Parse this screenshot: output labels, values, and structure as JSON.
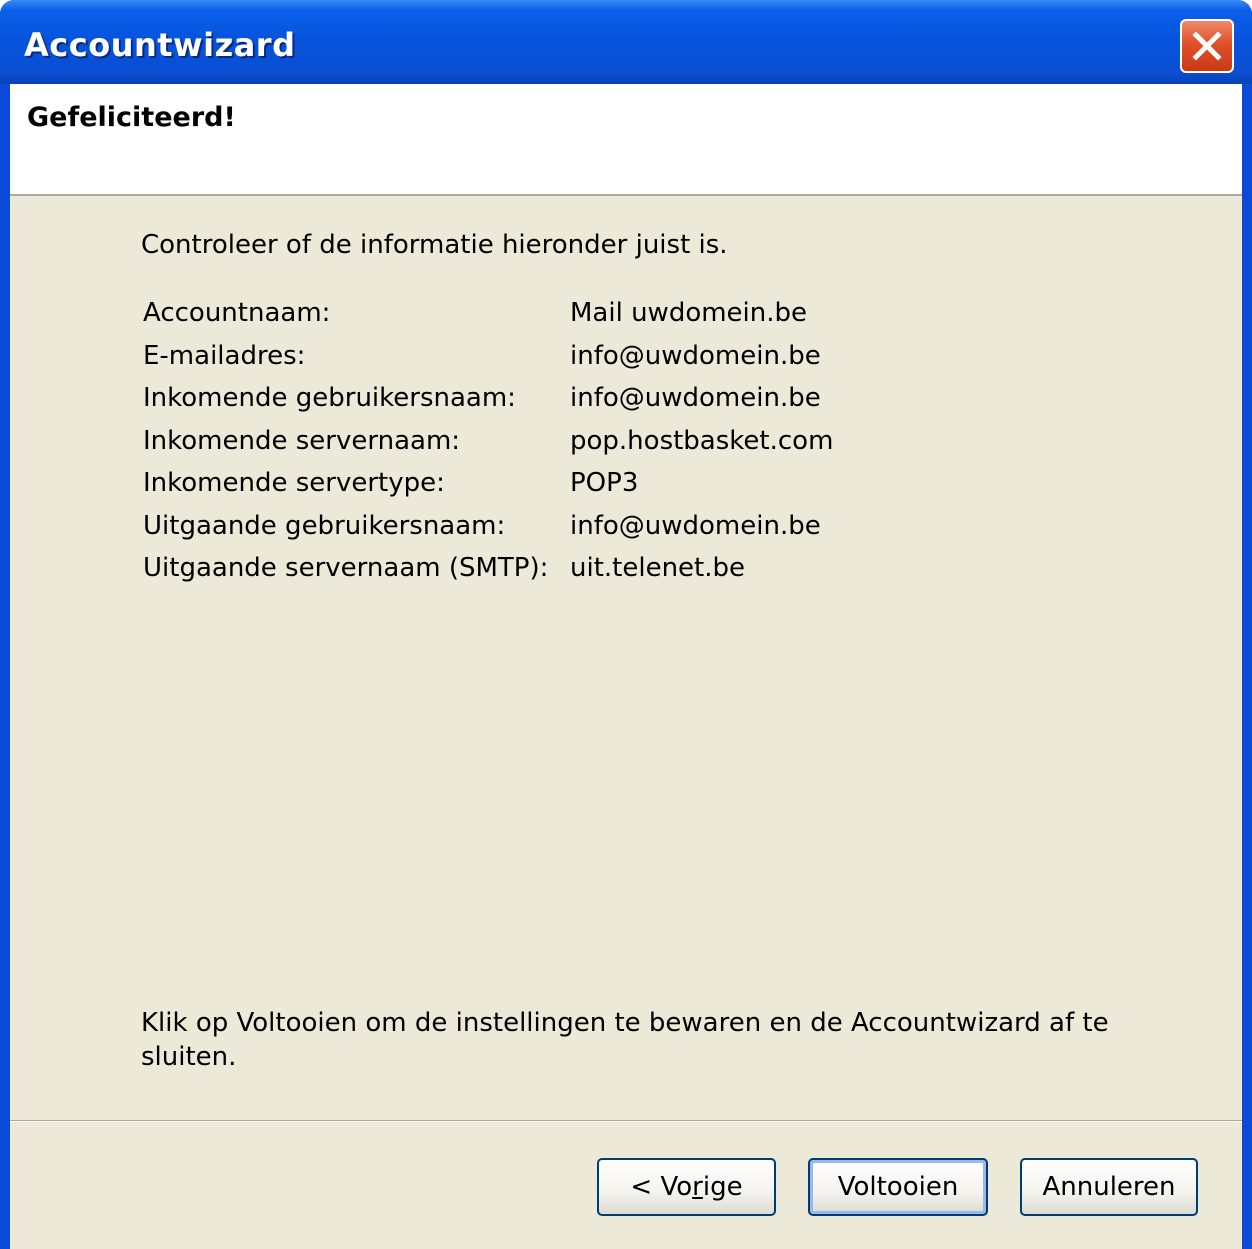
{
  "window": {
    "title": "Accountwizard",
    "close_icon": "close-icon"
  },
  "header": {
    "title": "Gefeliciteerd!"
  },
  "main": {
    "intro": "Controleer of de informatie hieronder juist is.",
    "rows": [
      {
        "label": "Accountnaam:",
        "value": "Mail uwdomein.be"
      },
      {
        "label": "E-mailadres:",
        "value": "info@uwdomein.be"
      },
      {
        "label": "Inkomende gebruikersnaam:",
        "value": "info@uwdomein.be"
      },
      {
        "label": "Inkomende servernaam:",
        "value": "pop.hostbasket.com"
      },
      {
        "label": "Inkomende servertype:",
        "value": "POP3"
      },
      {
        "label": "Uitgaande gebruikersnaam:",
        "value": "info@uwdomein.be"
      },
      {
        "label": "Uitgaande servernaam (SMTP):",
        "value": "uit.telenet.be"
      }
    ],
    "outro": "Klik op Voltooien om de instellingen te bewaren en de Accountwizard af te sluiten."
  },
  "buttons": {
    "back_prefix": "< Vo",
    "back_accesskey": "r",
    "back_suffix": "ige",
    "finish": "Voltooien",
    "cancel": "Annuleren"
  },
  "colors": {
    "titlebar": "#0653dc",
    "dialog_background": "#ece9d8",
    "close_button": "#e0502a",
    "button_border": "#003c74"
  }
}
